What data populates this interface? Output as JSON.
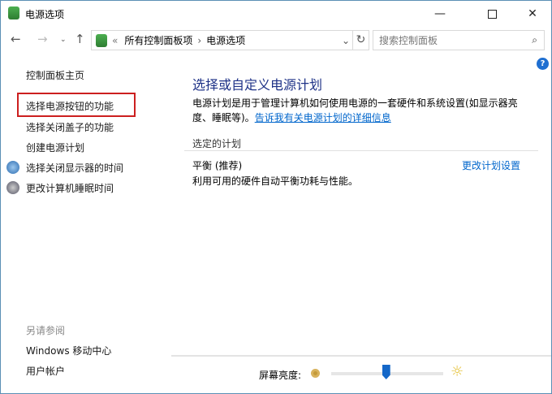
{
  "window": {
    "title": "电源选项",
    "minimize_icon": "minimize-icon",
    "maximize_icon": "maximize-icon",
    "close_icon": "close-icon"
  },
  "address": {
    "overflow": "«",
    "crumbs": [
      "所有控制面板项",
      "电源选项"
    ],
    "separator": "›"
  },
  "search": {
    "placeholder": "搜索控制面板"
  },
  "sidebar": {
    "home": "控制面板主页",
    "items": [
      "选择电源按钮的功能",
      "选择关闭盖子的功能",
      "创建电源计划",
      "选择关闭显示器的时间",
      "更改计算机睡眠时间"
    ],
    "see_also_title": "另请参阅",
    "see_also": [
      "Windows 移动中心",
      "用户帐户"
    ]
  },
  "main": {
    "heading": "选择或自定义电源计划",
    "desc_1": "电源计划是用于管理计算机如何使用电源的一套硬件和系统设置(如显示器亮",
    "desc_2": "度、睡眠等)。",
    "desc_link": "告诉我有关电源计划的详细信息",
    "section": "选定的计划",
    "plan_name": "平衡 (推荐)",
    "plan_desc": "利用可用的硬件自动平衡功耗与性能。",
    "change_link": "更改计划设置",
    "help": "?"
  },
  "brightness": {
    "label": "屏幕亮度:",
    "value_percent": 49
  },
  "colors": {
    "accent": "#0066cc",
    "heading": "#1e3287",
    "highlight_border": "#cc1f1f"
  }
}
